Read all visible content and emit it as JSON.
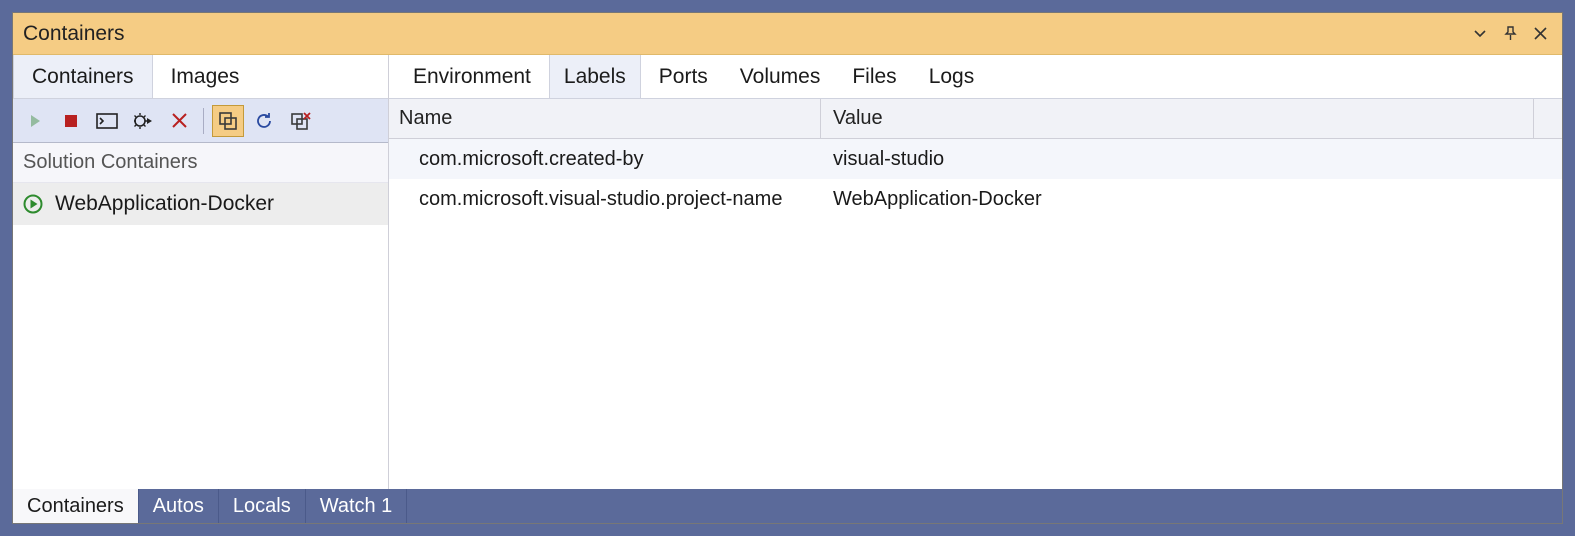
{
  "title": "Containers",
  "left": {
    "tabs": [
      {
        "label": "Containers",
        "active": true
      },
      {
        "label": "Images",
        "active": false
      }
    ],
    "toolbar": {
      "start": "start-icon",
      "stop": "stop-icon",
      "terminal": "terminal-icon",
      "settings": "settings-gear-icon",
      "remove": "remove-x-icon",
      "solution_containers": "solution-containers-icon",
      "refresh": "refresh-icon",
      "prune": "prune-icon"
    },
    "section_header": "Solution Containers",
    "containers": [
      {
        "name": "WebApplication-Docker",
        "status": "running",
        "selected": true
      }
    ]
  },
  "right": {
    "tabs": [
      {
        "label": "Environment",
        "active": false
      },
      {
        "label": "Labels",
        "active": true
      },
      {
        "label": "Ports",
        "active": false
      },
      {
        "label": "Volumes",
        "active": false
      },
      {
        "label": "Files",
        "active": false
      },
      {
        "label": "Logs",
        "active": false
      }
    ],
    "columns": {
      "name": "Name",
      "value": "Value"
    },
    "rows": [
      {
        "name": "com.microsoft.created-by",
        "value": "visual-studio"
      },
      {
        "name": "com.microsoft.visual-studio.project-name",
        "value": "WebApplication-Docker"
      }
    ]
  },
  "bottom_tabs": [
    {
      "label": "Containers",
      "active": true
    },
    {
      "label": "Autos",
      "active": false
    },
    {
      "label": "Locals",
      "active": false
    },
    {
      "label": "Watch 1",
      "active": false
    }
  ]
}
